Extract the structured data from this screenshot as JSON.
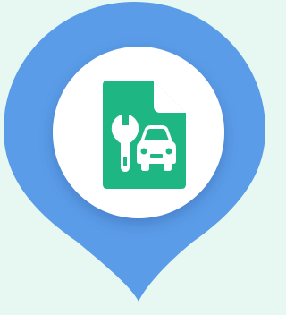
{
  "colors": {
    "background": "#e6f8f1",
    "pin": "#5b9ce8",
    "circle": "#ffffff",
    "document": "#1eb784",
    "document_fold": "#ffffff",
    "glyph": "#ffffff"
  },
  "icons": {
    "marker": "map-pin-icon",
    "document": "document-icon",
    "wrench": "wrench-icon",
    "car": "car-icon"
  }
}
